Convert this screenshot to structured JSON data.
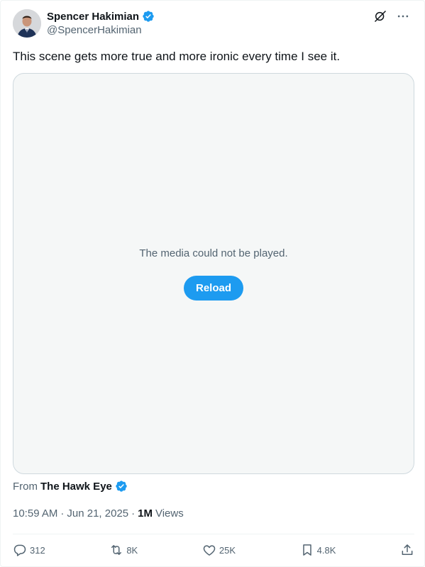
{
  "author": {
    "display_name": "Spencer Hakimian",
    "handle": "@SpencerHakimian",
    "verified_color": "#1d9bf0"
  },
  "icons": {
    "grok": "grok-icon",
    "more": "more-icon"
  },
  "tweet": {
    "text": "This scene gets more true and more ironic every time I see it."
  },
  "media": {
    "message": "The media could not be played.",
    "reload_label": "Reload"
  },
  "source": {
    "from_label": "From",
    "name": "The Hawk Eye"
  },
  "meta": {
    "time": "10:59 AM",
    "separator1": "·",
    "date": "Jun 21, 2025",
    "separator2": "·",
    "views_count": "1M",
    "views_label": "Views"
  },
  "actions": {
    "replies": "312",
    "reposts": "8K",
    "likes": "25K",
    "bookmarks": "4.8K"
  },
  "colors": {
    "accent": "#1d9bf0",
    "text_secondary": "#536471",
    "text_primary": "#0f1419"
  }
}
